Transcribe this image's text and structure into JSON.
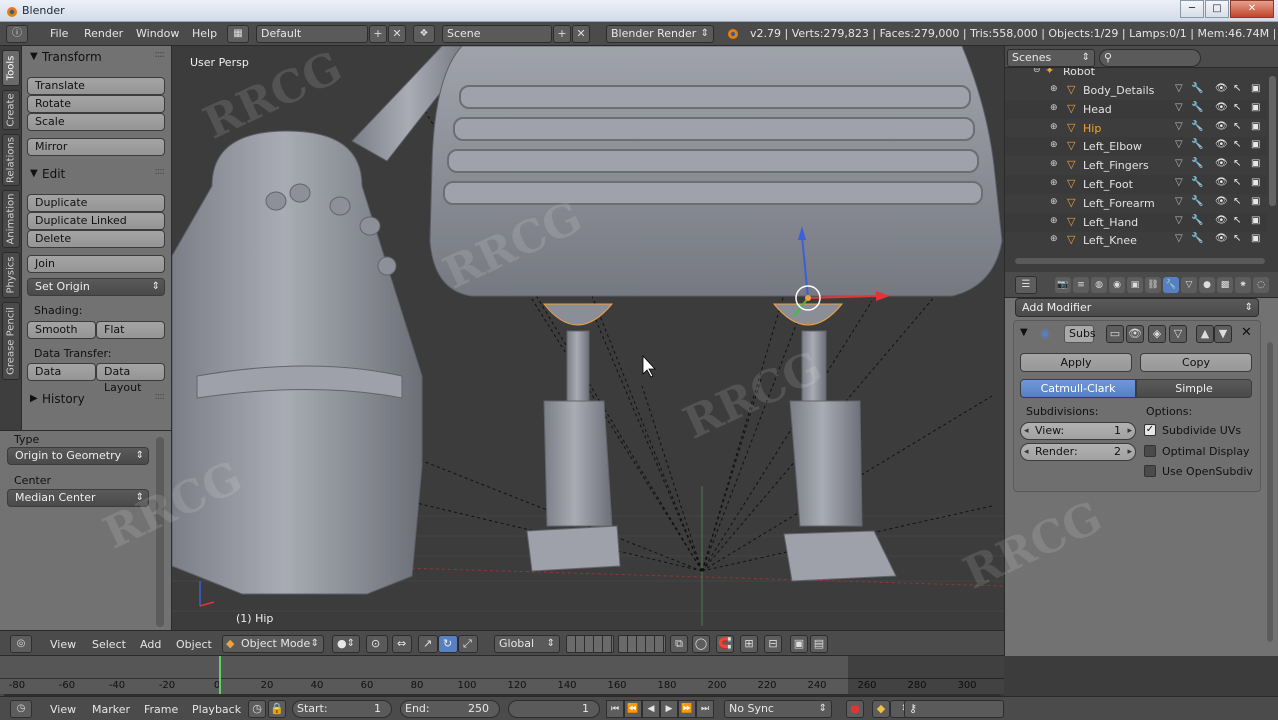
{
  "window": {
    "title": "Blender",
    "min": "─",
    "max": "□",
    "close": "✕"
  },
  "info": {
    "menus": [
      "File",
      "Render",
      "Window",
      "Help"
    ],
    "layout": "Default",
    "scene": "Scene",
    "engine": "Blender Render",
    "stats": "v2.79 | Verts:279,823 | Faces:279,000 | Tris:558,000 | Objects:1/29 | Lamps:0/1 | Mem:46.74M | Hip"
  },
  "tool_tabs": [
    "Tools",
    "Create",
    "Relations",
    "Animation",
    "Physics",
    "Grease Pencil"
  ],
  "toolshelf": {
    "transform": {
      "title": "Transform",
      "buttons": [
        "Translate",
        "Rotate",
        "Scale",
        "Mirror"
      ]
    },
    "edit": {
      "title": "Edit",
      "buttons": [
        "Duplicate",
        "Duplicate Linked",
        "Delete",
        "Join"
      ],
      "set_origin": "Set Origin"
    },
    "shading": {
      "label": "Shading:",
      "smooth": "Smooth",
      "flat": "Flat"
    },
    "data_transfer": {
      "label": "Data Transfer:",
      "data": "Data",
      "layout": "Data Layout"
    },
    "history": {
      "title": "History"
    }
  },
  "redo": {
    "type_label": "Type",
    "type_value": "Origin to Geometry",
    "center_label": "Center",
    "center_value": "Median Center"
  },
  "viewport": {
    "view_label": "User Persp",
    "object_label": "(1) Hip"
  },
  "outliner": {
    "display": "Scenes",
    "search_placeholder": "",
    "parent": "Robot",
    "items": [
      {
        "name": "Body_Details",
        "selected": false
      },
      {
        "name": "Head",
        "selected": false
      },
      {
        "name": "Hip",
        "selected": true
      },
      {
        "name": "Left_Elbow",
        "selected": false
      },
      {
        "name": "Left_Fingers",
        "selected": false
      },
      {
        "name": "Left_Foot",
        "selected": false
      },
      {
        "name": "Left_Forearm",
        "selected": false
      },
      {
        "name": "Left_Hand",
        "selected": false
      },
      {
        "name": "Left_Knee",
        "selected": false
      }
    ]
  },
  "properties": {
    "add_modifier": "Add Modifier",
    "modifier_name": "Subs",
    "apply": "Apply",
    "copy": "Copy",
    "catmull": "Catmull-Clark",
    "simple": "Simple",
    "subdivisions_label": "Subdivisions:",
    "options_label": "Options:",
    "view_label": "View:",
    "view_value": "1",
    "render_label": "Render:",
    "render_value": "2",
    "opt_subdivide_uvs": "Subdivide UVs",
    "opt_optimal_display": "Optimal Display",
    "opt_opensubdiv": "Use OpenSubdiv",
    "opt_states": [
      true,
      false,
      false
    ]
  },
  "view3d_header": {
    "menus": [
      "View",
      "Select",
      "Add",
      "Object"
    ],
    "mode": "Object Mode",
    "orientation": "Global"
  },
  "timeline": {
    "ticks": [
      "-80",
      "-60",
      "-40",
      "-20",
      "0",
      "20",
      "40",
      "60",
      "80",
      "100",
      "120",
      "140",
      "160",
      "180",
      "200",
      "220",
      "240",
      "260",
      "280",
      "300"
    ],
    "menus": [
      "View",
      "Marker",
      "Frame",
      "Playback"
    ],
    "start_label": "Start:",
    "start_value": "1",
    "end_label": "End:",
    "end_value": "250",
    "current_frame": "1",
    "sync": "No Sync"
  },
  "watermark": "RRCG"
}
